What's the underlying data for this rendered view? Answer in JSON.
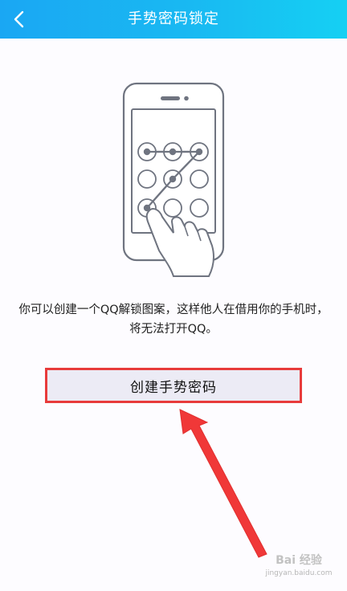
{
  "header": {
    "title": "手势密码锁定",
    "back_icon": "chevron-left-icon",
    "gradient_colors": [
      "#1aa7f3",
      "#15d0f3"
    ]
  },
  "illustration": {
    "icon": "phone-pattern-lock-illustration"
  },
  "description": {
    "text": "你可以创建一个QQ解锁图案，这样他人在借用你的手机时，将无法打开QQ。"
  },
  "primary_button": {
    "label": "创建手势密码",
    "highlight_color": "#e83b3b"
  },
  "annotation": {
    "arrow_color": "#f03838"
  },
  "watermark": {
    "line1": "Bai 经验",
    "line2": "jingyan.baidu.com"
  }
}
